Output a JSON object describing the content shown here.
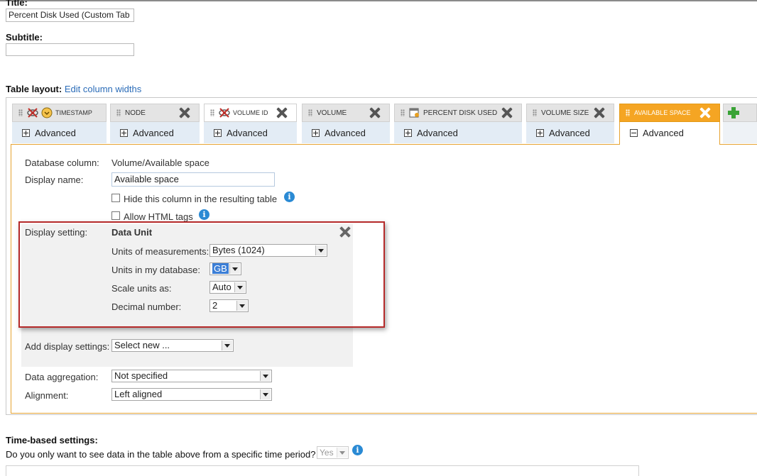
{
  "title_section": {
    "label": "Title:",
    "value": "Percent Disk Used (Custom Tab"
  },
  "subtitle_section": {
    "label": "Subtitle:",
    "value": ""
  },
  "table_layout": {
    "label": "Table layout:",
    "edit_link": "Edit column widths"
  },
  "columns": [
    {
      "name": "TIMESTAMP",
      "advanced": "Advanced"
    },
    {
      "name": "NODE",
      "advanced": "Advanced"
    },
    {
      "name": "VOLUME ID",
      "advanced": "Advanced"
    },
    {
      "name": "VOLUME",
      "advanced": "Advanced"
    },
    {
      "name": "PERCENT DISK USED",
      "advanced": "Advanced"
    },
    {
      "name": "VOLUME SIZE",
      "advanced": "Advanced"
    },
    {
      "name": "AVAILABLE SPACE",
      "advanced": "Advanced",
      "active": true
    }
  ],
  "panel": {
    "database_column_label": "Database column:",
    "database_column_value": "Volume/Available space",
    "display_name_label": "Display name:",
    "display_name_value": "Available space",
    "hide_column_label": "Hide this column in the resulting table",
    "allow_html_label": "Allow HTML tags",
    "display_setting_label": "Display setting:",
    "data_unit_title": "Data Unit",
    "units_measure_label": "Units of measurements:",
    "units_measure_value": "Bytes (1024)",
    "units_db_label": "Units in my database:",
    "units_db_value": "GB",
    "scale_label": "Scale units as:",
    "scale_value": "Auto",
    "decimal_label": "Decimal number:",
    "decimal_value": "2",
    "add_display_label": "Add display settings:",
    "add_display_value": "Select new ...",
    "aggregation_label": "Data aggregation:",
    "aggregation_value": "Not specified",
    "alignment_label": "Alignment:",
    "alignment_value": "Left aligned"
  },
  "time_settings": {
    "label": "Time-based settings:",
    "question": "Do you only want to see data in the table above from a specific time period?",
    "value": "Yes"
  },
  "colors": {
    "accent_orange": "#f5a523",
    "highlight_red": "#b52a2a",
    "link_blue": "#2b6cb8",
    "info_blue": "#2a8ad4"
  }
}
